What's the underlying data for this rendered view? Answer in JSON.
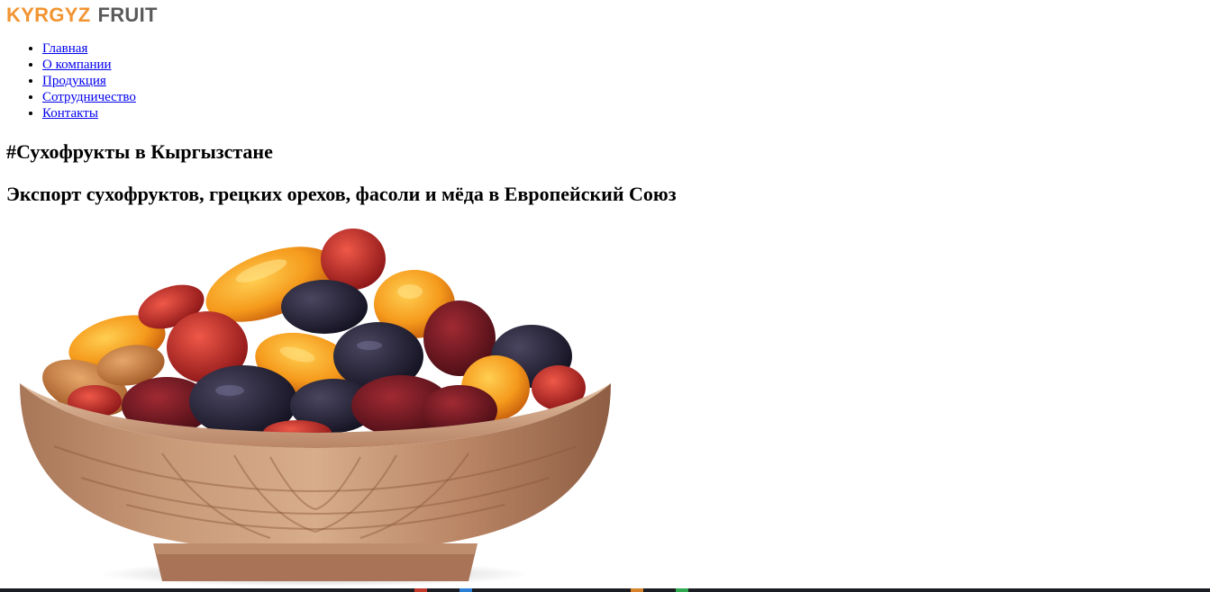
{
  "logo": {
    "part1": "KYRGYZ",
    "part2": "FRUIT",
    "part1_color": "#f29431",
    "part2_color": "#5a5a5a"
  },
  "nav": {
    "items": [
      {
        "label": "Главная"
      },
      {
        "label": "О компании"
      },
      {
        "label": "Продукция"
      },
      {
        "label": "Сотрудничество"
      },
      {
        "label": "Контакты"
      }
    ]
  },
  "main": {
    "heading": "#Сухофрукты в Кыргызстане",
    "subheading": "Экспорт сухофруктов, грецких орехов, фасоли и мёда в Европейский Союз",
    "hero_image": "bowl-of-dried-fruits"
  }
}
